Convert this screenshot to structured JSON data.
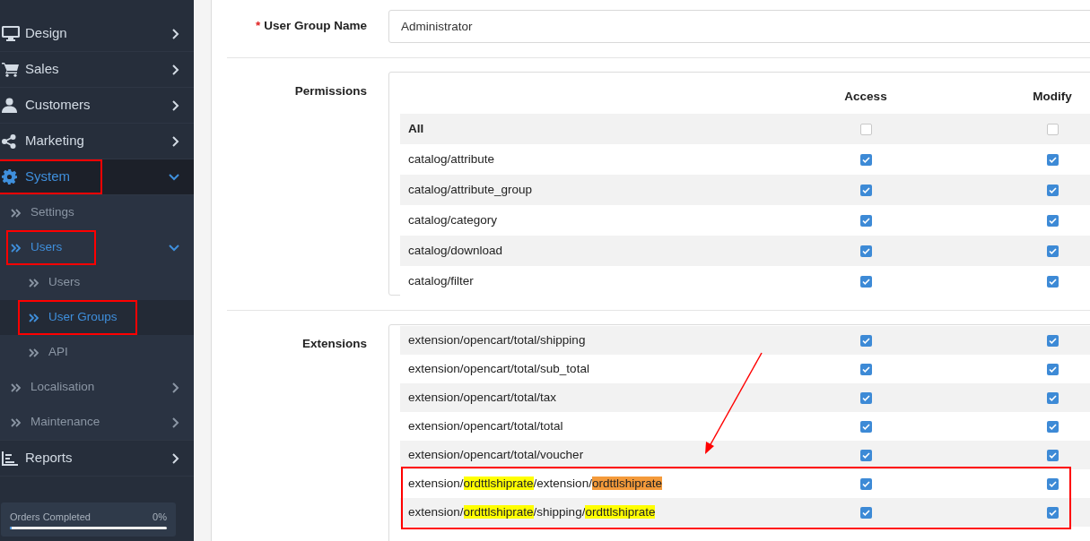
{
  "sidebar": {
    "items": [
      {
        "label": "Design",
        "expanded": false,
        "selected": false,
        "marked": false
      },
      {
        "label": "Sales",
        "expanded": false,
        "selected": false,
        "marked": false
      },
      {
        "label": "Customers",
        "expanded": false,
        "selected": false,
        "marked": false
      },
      {
        "label": "Marketing",
        "expanded": false,
        "selected": false,
        "marked": false
      },
      {
        "label": "System",
        "expanded": true,
        "selected": true,
        "marked": true,
        "children": [
          {
            "label": "Settings",
            "selected": false,
            "marked": false
          },
          {
            "label": "Users",
            "expanded": true,
            "selected": true,
            "marked": true,
            "children": [
              {
                "label": "Users",
                "selected": false,
                "marked": false
              },
              {
                "label": "User Groups",
                "selected": true,
                "marked": true
              },
              {
                "label": "API",
                "selected": false,
                "marked": false
              }
            ]
          },
          {
            "label": "Localisation",
            "expanded": false,
            "selected": false,
            "marked": false
          },
          {
            "label": "Maintenance",
            "expanded": false,
            "selected": false,
            "marked": false
          }
        ]
      },
      {
        "label": "Reports",
        "expanded": false,
        "selected": false,
        "marked": false
      }
    ],
    "progress": {
      "label": "Orders Completed",
      "reading": "0%",
      "level": 0
    }
  },
  "form": {
    "name_field": {
      "label": "User Group Name",
      "required_mark": "*",
      "value": "Administrator"
    },
    "permissions": {
      "label": "Permissions",
      "columns": [
        "Access",
        "Modify"
      ],
      "rows": [
        {
          "kind": "all",
          "path": "All",
          "access": false,
          "modify": false
        },
        {
          "kind": "path",
          "path": "catalog/attribute",
          "access": true,
          "modify": true
        },
        {
          "kind": "path",
          "path": "catalog/attribute_group",
          "access": true,
          "modify": true
        },
        {
          "kind": "path",
          "path": "catalog/category",
          "access": true,
          "modify": true
        },
        {
          "kind": "path",
          "path": "catalog/download",
          "access": true,
          "modify": true
        },
        {
          "kind": "path",
          "path": "catalog/filter",
          "access": true,
          "modify": true
        }
      ]
    },
    "extensions": {
      "label": "Extensions",
      "rows": [
        {
          "kind": "path",
          "path": "extension/opencart/total/shipping",
          "access": true,
          "modify": true,
          "marked": false
        },
        {
          "kind": "path",
          "path": "extension/opencart/total/sub_total",
          "access": true,
          "modify": true,
          "marked": false
        },
        {
          "kind": "path",
          "path": "extension/opencart/total/tax",
          "access": true,
          "modify": true,
          "marked": false
        },
        {
          "kind": "path",
          "path": "extension/opencart/total/total",
          "access": true,
          "modify": true,
          "marked": false
        },
        {
          "kind": "path",
          "path": "extension/opencart/total/voucher",
          "access": true,
          "modify": true,
          "marked": false
        },
        {
          "kind": "segments",
          "segments": [
            {
              "text": "extension/"
            },
            {
              "text": "ordttlshiprate",
              "color": "#ffff00"
            },
            {
              "text": "/extension/"
            },
            {
              "text": "ordttlshiprate",
              "color": "#f49a3a"
            }
          ],
          "access": true,
          "modify": true,
          "marked": true
        },
        {
          "kind": "segments",
          "segments": [
            {
              "text": "extension/"
            },
            {
              "text": "ordttlshiprate",
              "color": "#ffff00"
            },
            {
              "text": "/shipping/"
            },
            {
              "text": "ordttlshiprate",
              "color": "#ffff00"
            }
          ],
          "access": true,
          "modify": true,
          "marked": true
        }
      ]
    }
  }
}
